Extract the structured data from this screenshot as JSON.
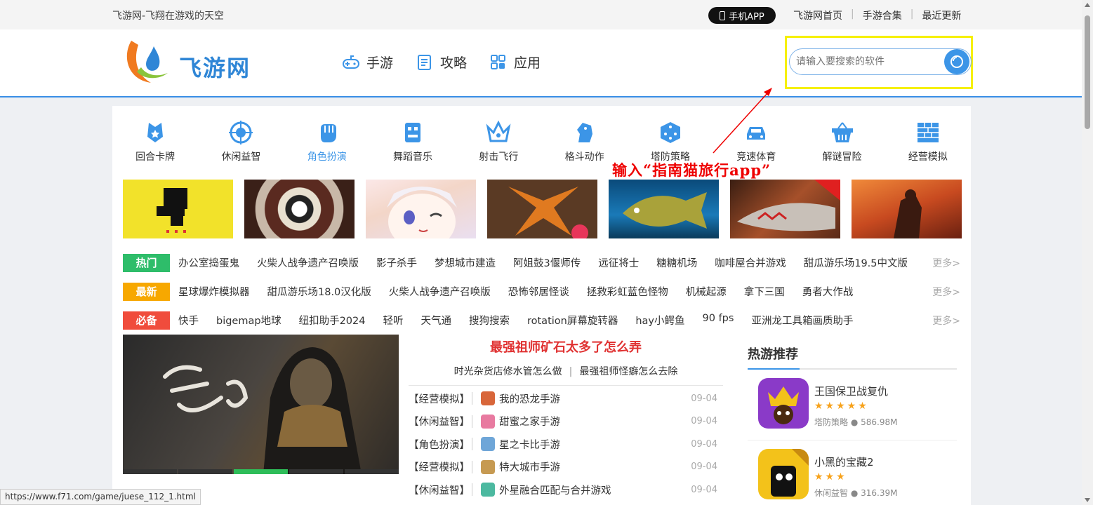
{
  "topbar": {
    "tagline": "飞游网-飞翔在游戏的天空",
    "app_button": "手机APP",
    "links": [
      "飞游网首页",
      "手游合集",
      "最近更新"
    ]
  },
  "header": {
    "logo_text": "飞游网",
    "nav": [
      {
        "label": "手游",
        "icon": "gamepad-icon"
      },
      {
        "label": "攻略",
        "icon": "guide-icon"
      },
      {
        "label": "应用",
        "icon": "apps-icon"
      }
    ],
    "search": {
      "placeholder": "请输入要搜索的软件",
      "value": ""
    }
  },
  "categories": [
    {
      "label": "回合卡牌",
      "icon": "card-icon"
    },
    {
      "label": "休闲益智",
      "icon": "target-icon"
    },
    {
      "label": "角色扮演",
      "icon": "fist-icon",
      "active": true
    },
    {
      "label": "舞蹈音乐",
      "icon": "robot-icon"
    },
    {
      "label": "射击飞行",
      "icon": "crown-icon"
    },
    {
      "label": "格斗动作",
      "icon": "knight-icon"
    },
    {
      "label": "塔防策略",
      "icon": "dice-icon"
    },
    {
      "label": "竞速体育",
      "icon": "car-icon"
    },
    {
      "label": "解谜冒险",
      "icon": "basket-icon"
    },
    {
      "label": "经营模拟",
      "icon": "brick-icon"
    }
  ],
  "annotation": "输入“指南猫旅行app”",
  "tag_rows": [
    {
      "badge": "热门",
      "color": "#2ebd6a",
      "links": [
        "办公室捣蛋鬼",
        "火柴人战争遗产召唤版",
        "影子杀手",
        "梦想城市建造",
        "阿姐鼓3偃师传",
        "远征将士",
        "糖糖机场",
        "咖啡屋合并游戏",
        "甜瓜游乐场19.5中文版"
      ],
      "more": "更多>"
    },
    {
      "badge": "最新",
      "color": "#f7a800",
      "links": [
        "星球爆炸模拟器",
        "甜瓜游乐场18.0汉化版",
        "火柴人战争遗产召唤版",
        "恐怖邻居怪谈",
        "拯救彩虹蓝色怪物",
        "机械起源",
        "拿下三国",
        "勇者大作战"
      ],
      "more": "更多>"
    },
    {
      "badge": "必备",
      "color": "#f04c3c",
      "links": [
        "快手",
        "bigemap地球",
        "纽扣助手2024",
        "轻听",
        "天气通",
        "搜狗搜索",
        "rotation屏幕旋转器",
        "hay小鳄鱼",
        "90 fps",
        "亚洲龙工具箱画质助手"
      ],
      "more": "更多>"
    }
  ],
  "news": {
    "headline": "最强祖师矿石太多了怎么弄",
    "sublinks": [
      "时光杂货店修水管怎么做",
      "最强祖师怪癖怎么去除"
    ],
    "items": [
      {
        "cat": "【经营模拟】",
        "title": "我的恐龙手游",
        "date": "09-04",
        "color": "#d8663a"
      },
      {
        "cat": "【休闲益智】",
        "title": "甜蜜之家手游",
        "date": "09-04",
        "color": "#e87aa0"
      },
      {
        "cat": "【角色扮演】",
        "title": "星之卡比手游",
        "date": "09-04",
        "color": "#6fa6d8"
      },
      {
        "cat": "【经营模拟】",
        "title": "特大城市手游",
        "date": "09-04",
        "color": "#c69a52"
      },
      {
        "cat": "【休闲益智】",
        "title": "外星融合匹配与合并游戏",
        "date": "09-04",
        "color": "#4cb9a0"
      }
    ]
  },
  "hot": {
    "title": "热游推荐",
    "items": [
      {
        "name": "王国保卫战复仇",
        "stars": "★★★★★",
        "category": "塔防策略",
        "size": "586.98M"
      },
      {
        "name": "小黑的宝藏2",
        "stars": "★★★",
        "category": "休闲益智",
        "size": "316.39M"
      }
    ]
  },
  "statusbar": "https://www.f71.com/game/juese_112_1.html",
  "colors": {
    "accent": "#3c95e7",
    "highlight": "#f6f000",
    "annotation": "#e00000"
  }
}
